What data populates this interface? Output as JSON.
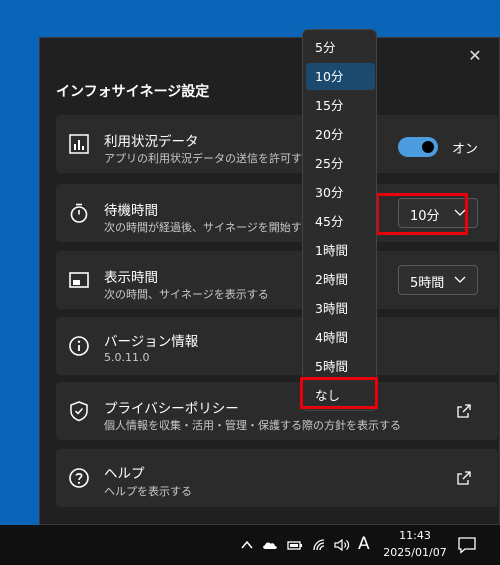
{
  "panel": {
    "title": "インフォサイネージ設定",
    "close_glyph": "✕"
  },
  "usage": {
    "label": "利用状況データ",
    "desc": "アプリの利用状況データの送信を許可する",
    "toggle_label": "オン",
    "toggle_on": true,
    "icon": "bar-chart-icon"
  },
  "standby": {
    "label": "待機時間",
    "desc": "次の時間が経過後、サイネージを開始する",
    "value": "10分",
    "icon": "timer-icon"
  },
  "display": {
    "label": "表示時間",
    "desc": "次の時間、サイネージを表示する",
    "value": "5時間",
    "icon": "display-window-icon"
  },
  "version": {
    "label": "バージョン情報",
    "desc": "5.0.11.0",
    "icon": "info-icon"
  },
  "privacy": {
    "label": "プライバシーポリシー",
    "desc": "個人情報を収集・活用・管理・保護する際の方針を表示する",
    "icon": "shield-icon"
  },
  "help": {
    "label": "ヘルプ",
    "desc": "ヘルプを表示する",
    "icon": "help-circle-icon"
  },
  "dropdown": {
    "selected": "10分",
    "options": [
      "5分",
      "10分",
      "15分",
      "20分",
      "25分",
      "30分",
      "45分",
      "1時間",
      "2時間",
      "3時間",
      "4時間",
      "5時間",
      "なし"
    ]
  },
  "taskbar": {
    "ime": "A",
    "time": "11:43",
    "date": "2025/01/07"
  },
  "colors": {
    "desktop": "#0a64b8",
    "panel": "#202020",
    "card": "#2b2b2b",
    "accent": "#4c9de0",
    "highlight": "#e8000b"
  }
}
